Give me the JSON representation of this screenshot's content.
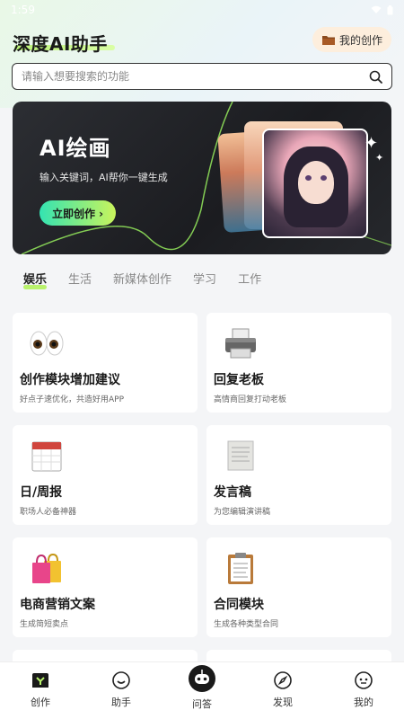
{
  "status": {
    "time": "1:59"
  },
  "header": {
    "title": "深度AI助手",
    "my_works_label": "我的创作"
  },
  "search": {
    "placeholder": "请输入想要搜索的功能"
  },
  "banner": {
    "title": "AI绘画",
    "subtitle": "输入关键词，AI帮你一键生成",
    "button_label": "立即创作 ›"
  },
  "tabs": [
    {
      "label": "娱乐",
      "active": true
    },
    {
      "label": "生活",
      "active": false
    },
    {
      "label": "新媒体创作",
      "active": false
    },
    {
      "label": "学习",
      "active": false
    },
    {
      "label": "工作",
      "active": false
    }
  ],
  "cards": [
    {
      "title": "创作模块增加建议",
      "desc": "好点子速优化，共造好用APP",
      "icon": "eyes-icon"
    },
    {
      "title": "回复老板",
      "desc": "高情商回复打动老板",
      "icon": "printer-icon"
    },
    {
      "title": "日/周报",
      "desc": "职场人必备神器",
      "icon": "calendar-icon"
    },
    {
      "title": "发言稿",
      "desc": "为您编辑演讲稿",
      "icon": "paper-scroll-icon"
    },
    {
      "title": "电商营销文案",
      "desc": "生成简短卖点",
      "icon": "shopping-bags-icon"
    },
    {
      "title": "合同模块",
      "desc": "生成各种类型合同",
      "icon": "clipboard-icon"
    }
  ],
  "nav": [
    {
      "label": "创作",
      "icon": "create-icon"
    },
    {
      "label": "助手",
      "icon": "smile-icon"
    },
    {
      "label": "问答",
      "icon": "robot-icon"
    },
    {
      "label": "发现",
      "icon": "compass-icon"
    },
    {
      "label": "我的",
      "icon": "profile-icon"
    }
  ],
  "colors": {
    "accent_green": "#b9f26c",
    "banner_btn_start": "#34e3b2",
    "banner_btn_end": "#c9f45c",
    "my_works_bg": "#fdeedd"
  }
}
